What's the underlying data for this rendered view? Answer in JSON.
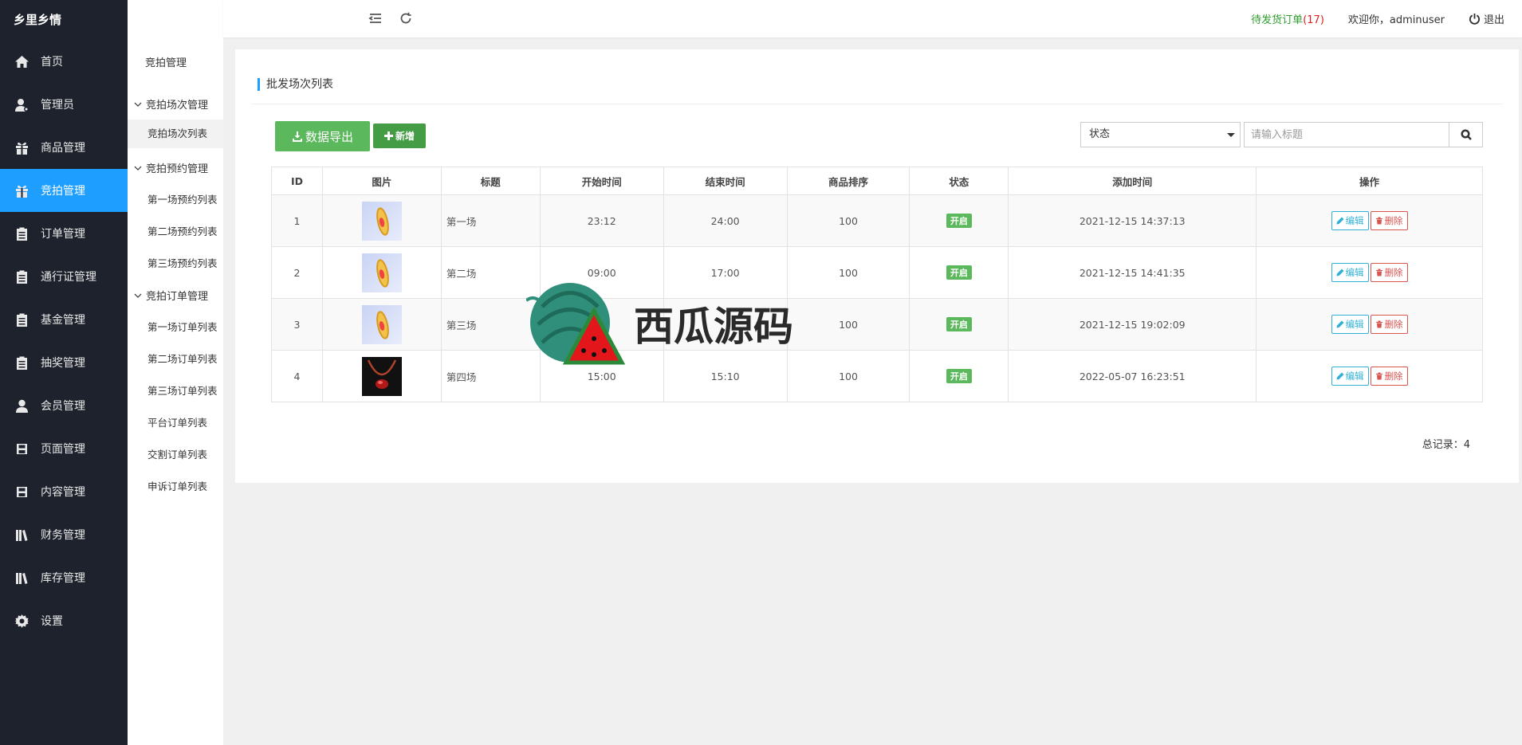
{
  "brand": "乡里乡情",
  "sidebar": {
    "items": [
      {
        "label": "首页",
        "icon": "home-icon"
      },
      {
        "label": "管理员",
        "icon": "admin-user-icon"
      },
      {
        "label": "商品管理",
        "icon": "gift-icon"
      },
      {
        "label": "竞拍管理",
        "icon": "gift-icon",
        "active": true
      },
      {
        "label": "订单管理",
        "icon": "clipboard-icon"
      },
      {
        "label": "通行证管理",
        "icon": "clipboard-icon"
      },
      {
        "label": "基金管理",
        "icon": "clipboard-icon"
      },
      {
        "label": "抽奖管理",
        "icon": "clipboard-icon"
      },
      {
        "label": "会员管理",
        "icon": "user-icon"
      },
      {
        "label": "页面管理",
        "icon": "floppy-icon"
      },
      {
        "label": "内容管理",
        "icon": "floppy-icon"
      },
      {
        "label": "财务管理",
        "icon": "books-icon"
      },
      {
        "label": "库存管理",
        "icon": "books-icon"
      },
      {
        "label": "设置",
        "icon": "gear-icon"
      }
    ]
  },
  "subnav": {
    "title": "竞拍管理",
    "groups": [
      {
        "label": "竞拍场次管理",
        "items": [
          "竞拍场次列表"
        ]
      },
      {
        "label": "竞拍预约管理",
        "items": [
          "第一场预约列表",
          "第二场预约列表",
          "第三场预约列表"
        ]
      },
      {
        "label": "竞拍订单管理",
        "items": [
          "第一场订单列表",
          "第二场订单列表",
          "第三场订单列表",
          "平台订单列表",
          "交割订单列表",
          "申诉订单列表"
        ]
      }
    ]
  },
  "topbar": {
    "pending_label": "待发货订单",
    "pending_count_open": "(",
    "pending_count": "17",
    "pending_count_close": ")",
    "welcome": "欢迎你，adminuser",
    "logout": "退出"
  },
  "main": {
    "title": "批发场次列表",
    "export_label": "数据导出",
    "add_label": "新增",
    "status_select": "状态",
    "search_placeholder": "请输入标题",
    "columns": [
      "ID",
      "图片",
      "标题",
      "开始时间",
      "结束时间",
      "商品排序",
      "状态",
      "添加时间",
      "操作"
    ],
    "rows": [
      {
        "id": "1",
        "title": "第一场",
        "start": "23:12",
        "end": "24:00",
        "sort": "100",
        "status": "开启",
        "added": "2021-12-15 14:37:13",
        "img": "bracelet"
      },
      {
        "id": "2",
        "title": "第二场",
        "start": "09:00",
        "end": "17:00",
        "sort": "100",
        "status": "开启",
        "added": "2021-12-15 14:41:35",
        "img": "bracelet"
      },
      {
        "id": "3",
        "title": "第三场",
        "start": "",
        "end": "",
        "sort": "100",
        "status": "开启",
        "added": "2021-12-15 19:02:09",
        "img": "bracelet"
      },
      {
        "id": "4",
        "title": "第四场",
        "start": "15:00",
        "end": "15:10",
        "sort": "100",
        "status": "开启",
        "added": "2022-05-07 16:23:51",
        "img": "necklace"
      }
    ],
    "edit_label": "编辑",
    "delete_label": "删除",
    "total": "总记录：4"
  },
  "watermark": {
    "text": "西瓜源码"
  },
  "colors": {
    "accent": "#1e9fff",
    "sidebar_bg": "#1e222d",
    "success": "#5cb85c",
    "danger": "#d9534f",
    "info": "#31b0d5"
  }
}
